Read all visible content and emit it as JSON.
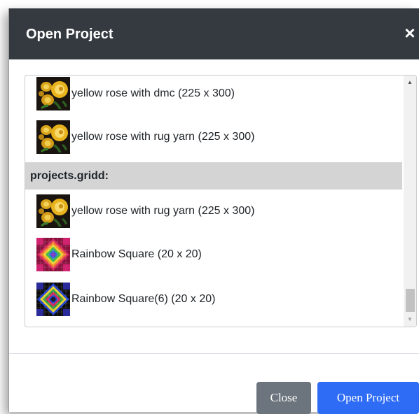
{
  "dialog": {
    "title": "Open Project",
    "close_glyph": "×"
  },
  "list": {
    "items_before_group": [
      {
        "label": "yellow rose with dmc (225 x 300)",
        "icon": "yellow-rose-thumbnail"
      },
      {
        "label": "yellow rose with rug yarn (225 x 300)",
        "icon": "yellow-rose-thumbnail"
      }
    ],
    "group": {
      "label": "projects.gridd:",
      "items": [
        {
          "label": "yellow rose with rug yarn (225 x 300)",
          "icon": "yellow-rose-thumbnail"
        },
        {
          "label": "Rainbow Square (20 x 20)",
          "icon": "rainbow-square-thumbnail"
        },
        {
          "label": "Rainbow Square(6) (20 x 20)",
          "icon": "rainbow-square-6-thumbnail"
        }
      ]
    },
    "scroll_up_glyph": "▲",
    "scroll_down_glyph": "▼"
  },
  "footer": {
    "close_label": "Close",
    "open_label": "Open Project"
  },
  "colors": {
    "header_bg": "#343a40",
    "group_bg": "#d4d4d4",
    "close_button": "#6c757d",
    "open_button": "#2f6cf6"
  }
}
